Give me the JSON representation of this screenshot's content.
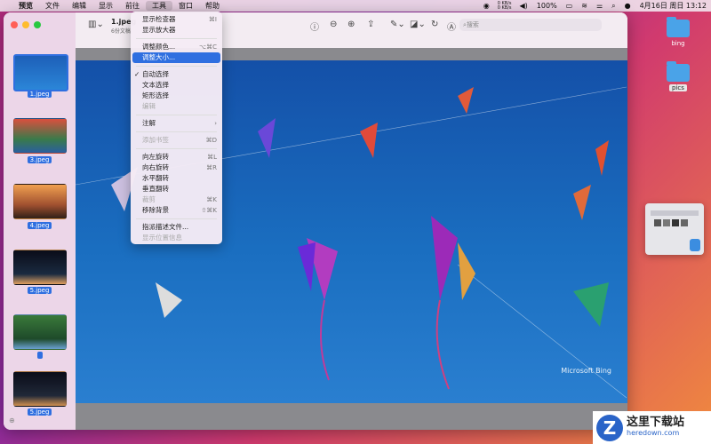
{
  "menubar": {
    "apple": "",
    "items": [
      "预览",
      "文件",
      "编辑",
      "显示",
      "前往",
      "工具",
      "窗口",
      "帮助"
    ],
    "active_index": 5,
    "net_up": "0 KB/s",
    "net_down": "0 KB/s",
    "battery": "100%",
    "datetime": "4月16日 周日  13:12"
  },
  "window": {
    "doc_title": "1.jpeg",
    "doc_subtitle": "6份文稿",
    "search_placeholder": "搜索",
    "watermark": "Microsoft Bing"
  },
  "thumbnails": [
    {
      "label": "1.jpeg",
      "selected": true
    },
    {
      "label": "3.jpeg",
      "selected": false
    },
    {
      "label": "4.jpeg",
      "selected": false
    },
    {
      "label": "5.jpeg",
      "selected": false
    },
    {
      "label": "",
      "selected": false
    },
    {
      "label": "5.jpeg",
      "selected": false
    }
  ],
  "tools_menu": [
    {
      "label": "显示检查器",
      "shortcut": "⌘I",
      "disabled": false
    },
    {
      "label": "显示放大器",
      "shortcut": "",
      "disabled": false
    },
    {
      "sep": true
    },
    {
      "label": "调整颜色...",
      "shortcut": "⌥⌘C",
      "disabled": false
    },
    {
      "label": "调整大小...",
      "shortcut": "",
      "disabled": false,
      "highlighted": true
    },
    {
      "sep": true
    },
    {
      "label": "自动选择",
      "shortcut": "",
      "disabled": false,
      "checked": true
    },
    {
      "label": "文本选择",
      "shortcut": "",
      "disabled": false
    },
    {
      "label": "矩形选择",
      "shortcut": "",
      "disabled": false
    },
    {
      "label": "编辑",
      "shortcut": "",
      "disabled": true
    },
    {
      "sep": true
    },
    {
      "label": "注解",
      "shortcut": "›",
      "disabled": false
    },
    {
      "sep": true
    },
    {
      "label": "添加书签",
      "shortcut": "⌘D",
      "disabled": true
    },
    {
      "sep": true
    },
    {
      "label": "向左旋转",
      "shortcut": "⌘L",
      "disabled": false
    },
    {
      "label": "向右旋转",
      "shortcut": "⌘R",
      "disabled": false
    },
    {
      "label": "水平翻转",
      "shortcut": "",
      "disabled": false
    },
    {
      "label": "垂直翻转",
      "shortcut": "",
      "disabled": false
    },
    {
      "label": "裁剪",
      "shortcut": "⌘K",
      "disabled": true
    },
    {
      "label": "移除背景",
      "shortcut": "⇧⌘K",
      "disabled": false
    },
    {
      "sep": true
    },
    {
      "label": "指派描述文件...",
      "shortcut": "",
      "disabled": false
    },
    {
      "label": "显示位置信息",
      "shortcut": "",
      "disabled": true
    }
  ],
  "desktop": {
    "icons": [
      "bing",
      "pics"
    ]
  },
  "watermark_logo": {
    "mark": "Z",
    "cn": "这里下载站",
    "en": "heredown.com"
  },
  "colors": {
    "accent": "#2f6fe0",
    "sky": "#1a6ec0"
  }
}
